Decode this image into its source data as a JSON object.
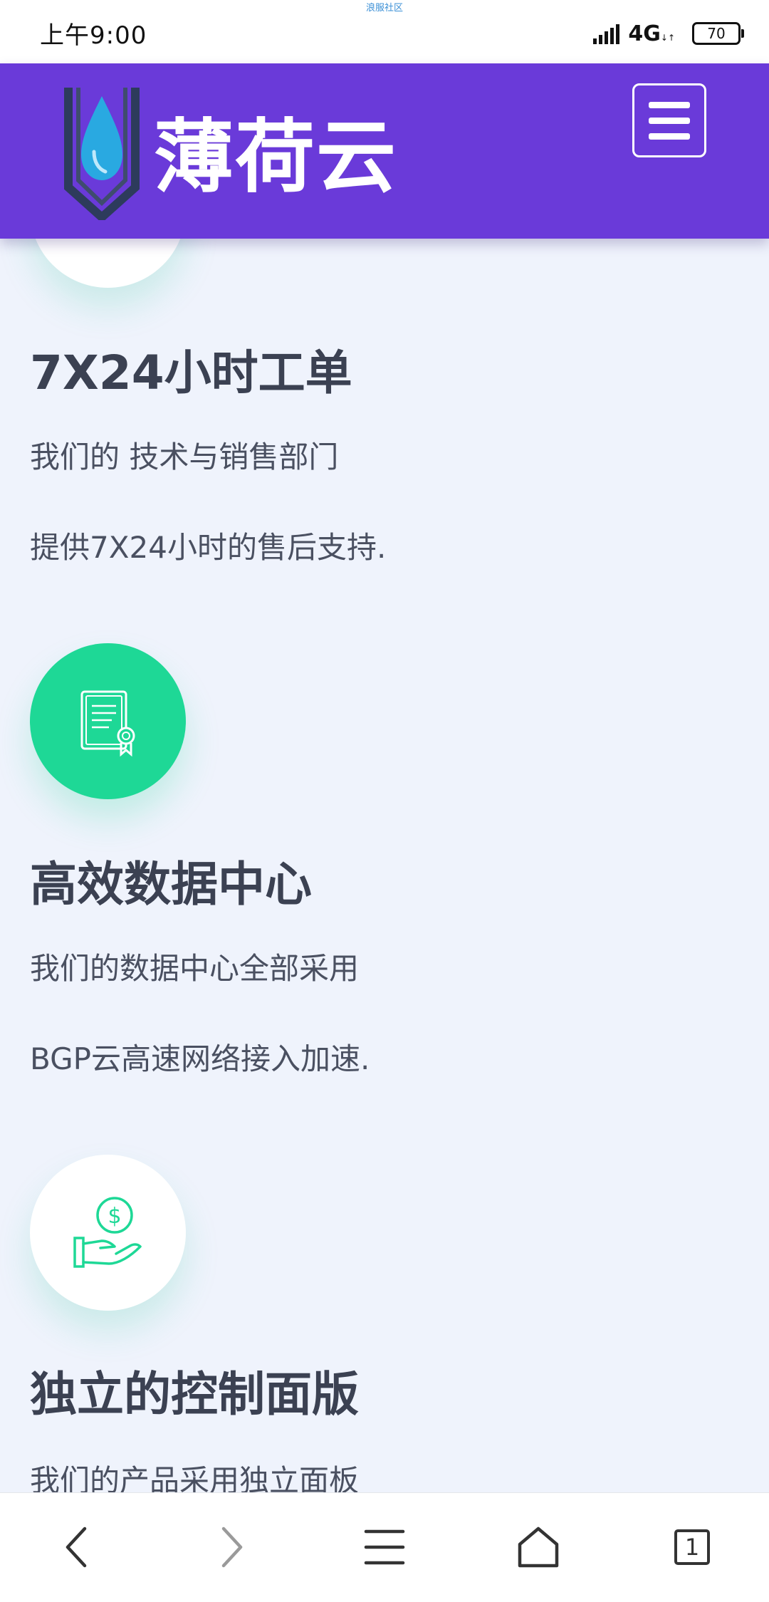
{
  "status_bar": {
    "time": "上午9:00",
    "watermark": "浪服社区",
    "network": "4G",
    "battery": "70"
  },
  "navbar": {
    "logo_text": "薄荷云",
    "menu_icon": "hamburger-menu-icon"
  },
  "features": [
    {
      "icon": "clock-support-icon",
      "title": "7X24小时工单",
      "desc_line1": "我们的 技术与销售部门",
      "desc_line2": "提供7X24小时的售后支持."
    },
    {
      "icon": "certificate-icon",
      "title": "高效数据中心",
      "desc_line1": "我们的数据中心全部采用",
      "desc_line2": "BGP云高速网络接入加速."
    },
    {
      "icon": "money-hand-icon",
      "title": "独立的控制面版",
      "desc_line1": "我们的产品采用独立面板",
      "desc_line2": ""
    }
  ],
  "bottom_bar": {
    "tab_count": "1"
  },
  "colors": {
    "brand_purple": "#6a3ad9",
    "accent_green": "#1ed896",
    "page_bg": "#eff3fc"
  }
}
